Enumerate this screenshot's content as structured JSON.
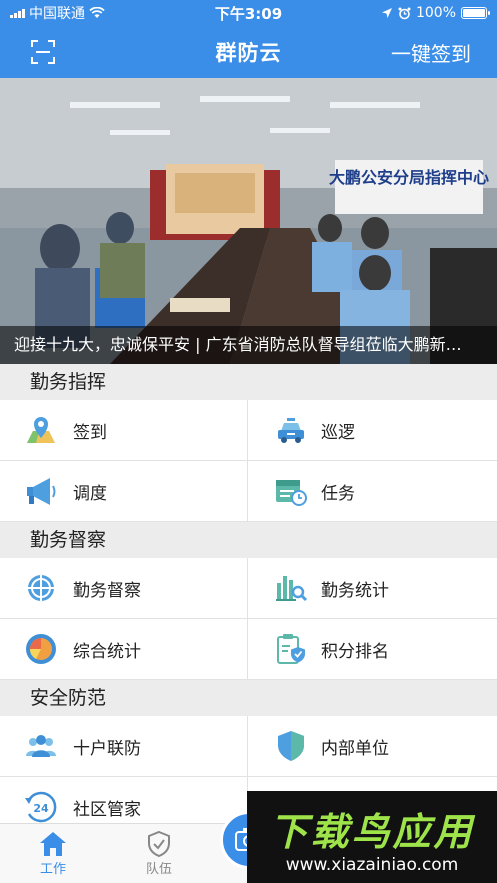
{
  "status_bar": {
    "carrier": "中国联通",
    "time": "下午3:09",
    "battery": "100%",
    "battery_level": 1.0
  },
  "nav": {
    "title": "群防云",
    "right_action": "一键签到",
    "left_icon": "scan-icon"
  },
  "banner": {
    "caption": "迎接十九大，忠诚保平安 | 广东省消防总队督导组莅临大鹏新…",
    "wall_sign": "大鹏公安分局指挥中心"
  },
  "sections": [
    {
      "title": "勤务指挥",
      "items": [
        {
          "label": "签到",
          "icon": "map-pin-icon"
        },
        {
          "label": "巡逻",
          "icon": "police-car-icon"
        },
        {
          "label": "调度",
          "icon": "megaphone-icon"
        },
        {
          "label": "任务",
          "icon": "calendar-clock-icon"
        }
      ]
    },
    {
      "title": "勤务督察",
      "items": [
        {
          "label": "勤务督察",
          "icon": "crosshair-icon"
        },
        {
          "label": "勤务统计",
          "icon": "bar-chart-search-icon"
        },
        {
          "label": "综合统计",
          "icon": "pie-gauge-icon"
        },
        {
          "label": "积分排名",
          "icon": "clipboard-shield-icon"
        }
      ]
    },
    {
      "title": "安全防范",
      "items": [
        {
          "label": "十户联防",
          "icon": "people-group-icon"
        },
        {
          "label": "内部单位",
          "icon": "shield-icon"
        },
        {
          "label": "社区管家",
          "icon": "clock-24-icon"
        }
      ]
    }
  ],
  "tabbar": {
    "tabs": [
      {
        "label": "工作",
        "icon": "home-icon"
      },
      {
        "label": "队伍",
        "icon": "shield-check-icon"
      }
    ],
    "center_icon": "camera-icon"
  },
  "watermark": {
    "title": "下载鸟应用",
    "url": "www.xiazainiao.com"
  },
  "colors": {
    "primary": "#3b8ee8",
    "section_bg": "#ececec",
    "watermark_green": "#9ee34a"
  }
}
